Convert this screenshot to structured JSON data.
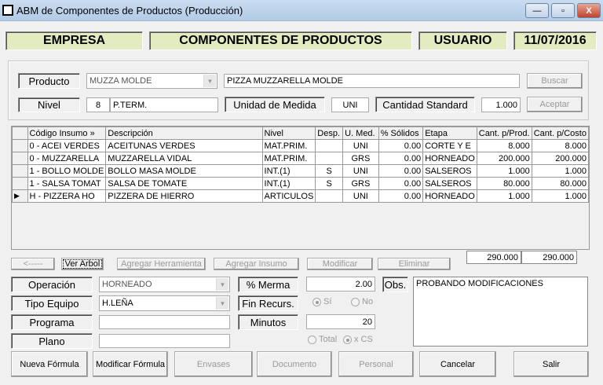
{
  "window": {
    "title": "ABM de Componentes de Productos (Producción)",
    "minimize": "—",
    "maximize": "▫",
    "close": "X"
  },
  "header": {
    "empresa": "EMPRESA",
    "title": "COMPONENTES DE PRODUCTOS",
    "usuario": "USUARIO",
    "date": "11/07/2016"
  },
  "producto": {
    "label": "Producto",
    "code": "MUZZA MOLDE",
    "description": "PIZZA MUZZARELLA MOLDE",
    "buscar": "Buscar"
  },
  "nivel": {
    "label": "Nivel",
    "value": "8",
    "name": "P.TERM.",
    "unidad_label": "Unidad de Medida",
    "unidad": "UNI",
    "cantidad_label": "Cantidad Standard",
    "cantidad": "1.000",
    "aceptar": "Aceptar"
  },
  "grid": {
    "columns": [
      "Código Insumo »",
      "Descripción",
      "Nivel",
      "Desp.",
      "U. Med.",
      "% Sólidos",
      "Etapa",
      "Cant. p/Prod.",
      "Cant. p/Costo"
    ],
    "rows": [
      [
        "0 - ACEI VERDES",
        "ACEITUNAS VERDES",
        "MAT.PRIM.",
        "",
        "UNI",
        "0.00",
        "CORTE Y E",
        "8.000",
        "8.000"
      ],
      [
        "0 - MUZZARELLA",
        "MUZZARELLA VIDAL",
        "MAT.PRIM.",
        "",
        "GRS",
        "0.00",
        "HORNEADO",
        "200.000",
        "200.000"
      ],
      [
        "1 - BOLLO MOLDE",
        "BOLLO MASA MOLDE",
        "INT.(1)",
        "S",
        "UNI",
        "0.00",
        "SALSEROS",
        "1.000",
        "1.000"
      ],
      [
        "1 - SALSA TOMAT",
        "SALSA DE TOMATE",
        "INT.(1)",
        "S",
        "GRS",
        "0.00",
        "SALSEROS",
        "80.000",
        "80.000"
      ],
      [
        "H - PIZZERA HO",
        "PIZZERA DE HIERRO",
        "ARTICULOS",
        "",
        "UNI",
        "0.00",
        "HORNEADO",
        "1.000",
        "1.000"
      ]
    ],
    "current_row": 4,
    "total_prod": "290.000",
    "total_costo": "290.000"
  },
  "actions": {
    "back": "<-----",
    "ver_arbol": "Ver Arbol",
    "agregar_herramienta": "Agregar Herramienta",
    "agregar_insumo": "Agregar Insumo",
    "modificar": "Modificar",
    "eliminar": "Eliminar"
  },
  "details": {
    "operacion_label": "Operación",
    "operacion": "HORNEADO",
    "tipo_equipo_label": "Tipo Equipo",
    "tipo_equipo": "H.LEÑA",
    "programa_label": "Programa",
    "programa": "",
    "plano_label": "Plano",
    "plano": "",
    "merma_label": "% Merma",
    "merma": "2.00",
    "fin_recurs_label": "Fin Recurs.",
    "si": "Sí",
    "no": "No",
    "fin_recurs_selected": "Sí",
    "minutos_label": "Minutos",
    "minutos": "20",
    "total": "Total",
    "xcs": "x CS",
    "mode_selected": "x CS",
    "obs_label": "Obs.",
    "obs": "PROBANDO MODIFICACIONES"
  },
  "footer": {
    "nueva": "Nueva Fórmula",
    "modificar": "Modificar Fórmula",
    "envases": "Envases",
    "documento": "Documento",
    "personal": "Personal",
    "cancelar": "Cancelar",
    "salir": "Salir"
  }
}
